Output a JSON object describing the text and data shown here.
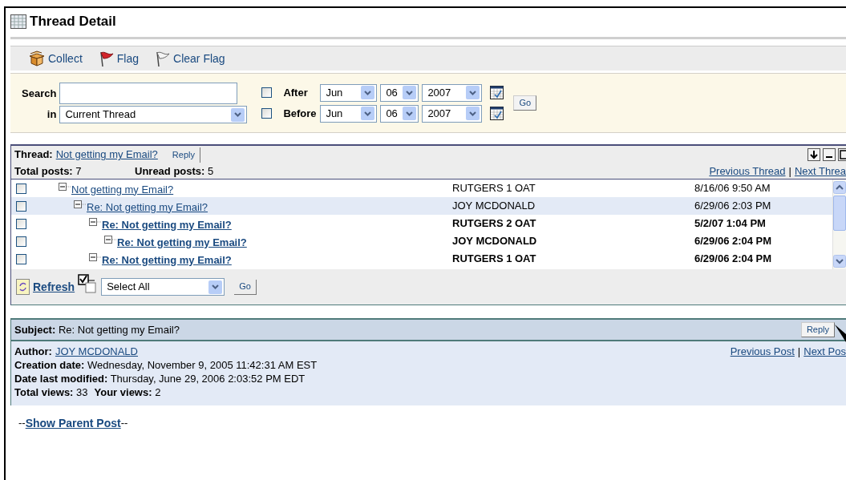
{
  "page": {
    "title": "Thread Detail"
  },
  "toolbar": [
    {
      "kind": "collect",
      "label": "Collect"
    },
    {
      "kind": "flag",
      "label": "Flag"
    },
    {
      "kind": "clear_flag",
      "label": "Clear Flag"
    }
  ],
  "search": {
    "label": "Search",
    "in_label": "in",
    "scope": "Current Thread",
    "dates": [
      {
        "label": "After",
        "checked": false,
        "month": "Jun",
        "day": "06",
        "year": "2007"
      },
      {
        "label": "Before",
        "checked": false,
        "month": "Jun",
        "day": "06",
        "year": "2007"
      }
    ],
    "go": "Go"
  },
  "thread": {
    "label": "Thread:",
    "title": "Not getting my Email?",
    "reply": "Reply",
    "total_label": "Total posts:",
    "total": "7",
    "unread_label": "Unread posts:",
    "unread": "5",
    "previous": "Previous Thread",
    "separator": "|",
    "next": "Next Threa",
    "posts": [
      {
        "title": "Not getting my Email?",
        "author": "RUTGERS 1 OAT",
        "date": "8/16/06 9:50 AM",
        "unread": false,
        "selected": false,
        "checked": false,
        "expanded": true,
        "children": [
          {
            "title": "Re: Not getting my Email?",
            "author": "JOY MCDONALD",
            "date": "6/29/06 2:03 PM",
            "unread": false,
            "selected": true,
            "checked": false,
            "expanded": true,
            "children": [
              {
                "title": "Re: Not getting my Email?",
                "author": "RUTGERS 2 OAT",
                "date": "5/2/07 1:04 PM",
                "unread": true,
                "selected": false,
                "checked": false,
                "expanded": true,
                "children": [
                  {
                    "title": "Re: Not getting my Email?",
                    "author": "JOY MCDONALD",
                    "date": "6/29/06 2:04 PM",
                    "unread": true,
                    "selected": false,
                    "checked": false,
                    "expanded": true
                  }
                ]
              },
              {
                "title": "Re: Not getting my Email?",
                "author": "RUTGERS 1 OAT",
                "date": "6/29/06 2:04 PM",
                "unread": true,
                "selected": false,
                "checked": false,
                "expanded": true
              }
            ]
          }
        ]
      }
    ],
    "refresh": "Refresh",
    "bulk_action": "Select All",
    "go": "Go"
  },
  "post": {
    "subject_label": "Subject:",
    "subject": "Re: Not getting my Email?",
    "reply": "Reply",
    "author_label": "Author:",
    "author": "JOY MCDONALD",
    "previous": "Previous Post",
    "separator": "|",
    "next": "Next Pos",
    "meta": [
      {
        "label": "Creation date:",
        "value": "Wednesday, November 9, 2005 11:42:31 AM EST"
      },
      {
        "label": "Date last modified:",
        "value": "Thursday, June 29, 2006 2:03:52 PM EDT"
      }
    ],
    "views": [
      {
        "label": "Total views:",
        "value": "33"
      },
      {
        "label": "Your views:",
        "value": "2"
      }
    ],
    "show_parent": "Show Parent Post",
    "dashes": "--"
  }
}
